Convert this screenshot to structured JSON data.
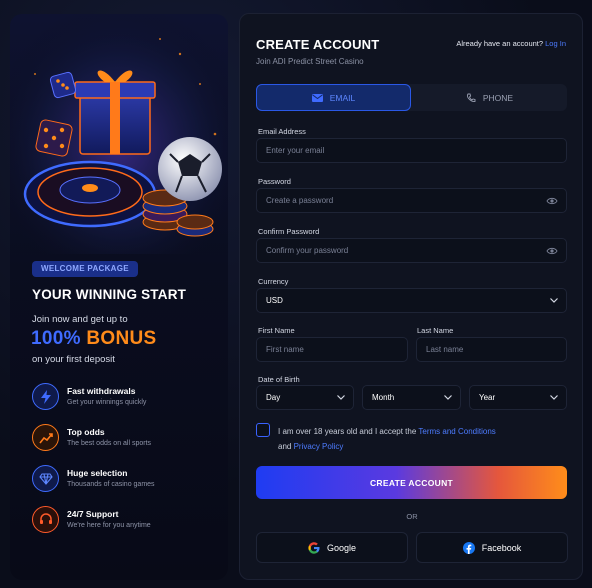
{
  "promo": {
    "badge": "WELCOME PACKAGE",
    "title": "YOUR WINNING START",
    "subtitle": "Join now and get up to",
    "bonus_percent": "100%",
    "bonus_word": "BONUS",
    "subtitle2": "on your first deposit",
    "features": [
      {
        "icon": "lightning-icon",
        "title": "Fast withdrawals",
        "desc": "Get your winnings quickly",
        "color": "#3f6bff"
      },
      {
        "icon": "chart-up-icon",
        "title": "Top odds",
        "desc": "The best odds on all sports",
        "color": "#ff7a1a"
      },
      {
        "icon": "diamond-icon",
        "title": "Huge selection",
        "desc": "Thousands of casino games",
        "color": "#3f6bff"
      },
      {
        "icon": "headset-icon",
        "title": "24/7 Support",
        "desc": "We're here for you anytime",
        "color": "#ff5a2a"
      }
    ]
  },
  "form": {
    "title": "CREATE ACCOUNT",
    "subtitle": "Join ADI Predict Street Casino",
    "have_account": "Already have an account?",
    "login_link": "Log In",
    "tabs": [
      {
        "label": "EMAIL",
        "active": true
      },
      {
        "label": "PHONE",
        "active": false
      }
    ],
    "email_label": "Email Address",
    "email_placeholder": "Enter your email",
    "password_label": "Password",
    "password_placeholder": "Create a password",
    "confirm_label": "Confirm Password",
    "confirm_placeholder": "Confirm your password",
    "currency_label": "Currency",
    "currency_value": "USD",
    "first_name_label": "First Name",
    "first_name_placeholder": "First name",
    "last_name_label": "Last Name",
    "last_name_placeholder": "Last name",
    "dob_label": "Date of Birth",
    "dob_day": "Day",
    "dob_month": "Month",
    "dob_year": "Year",
    "terms_prefix": "I am over 18 years old and I accept the",
    "terms_link": "Terms and Conditions",
    "terms_and": "and",
    "privacy_link": "Privacy Policy",
    "submit": "CREATE ACCOUNT",
    "or": "OR",
    "google": "Google",
    "facebook": "Facebook"
  },
  "colors": {
    "accent": "#3f6bff",
    "orange": "#ff8b1a",
    "card": "#0f1320"
  }
}
